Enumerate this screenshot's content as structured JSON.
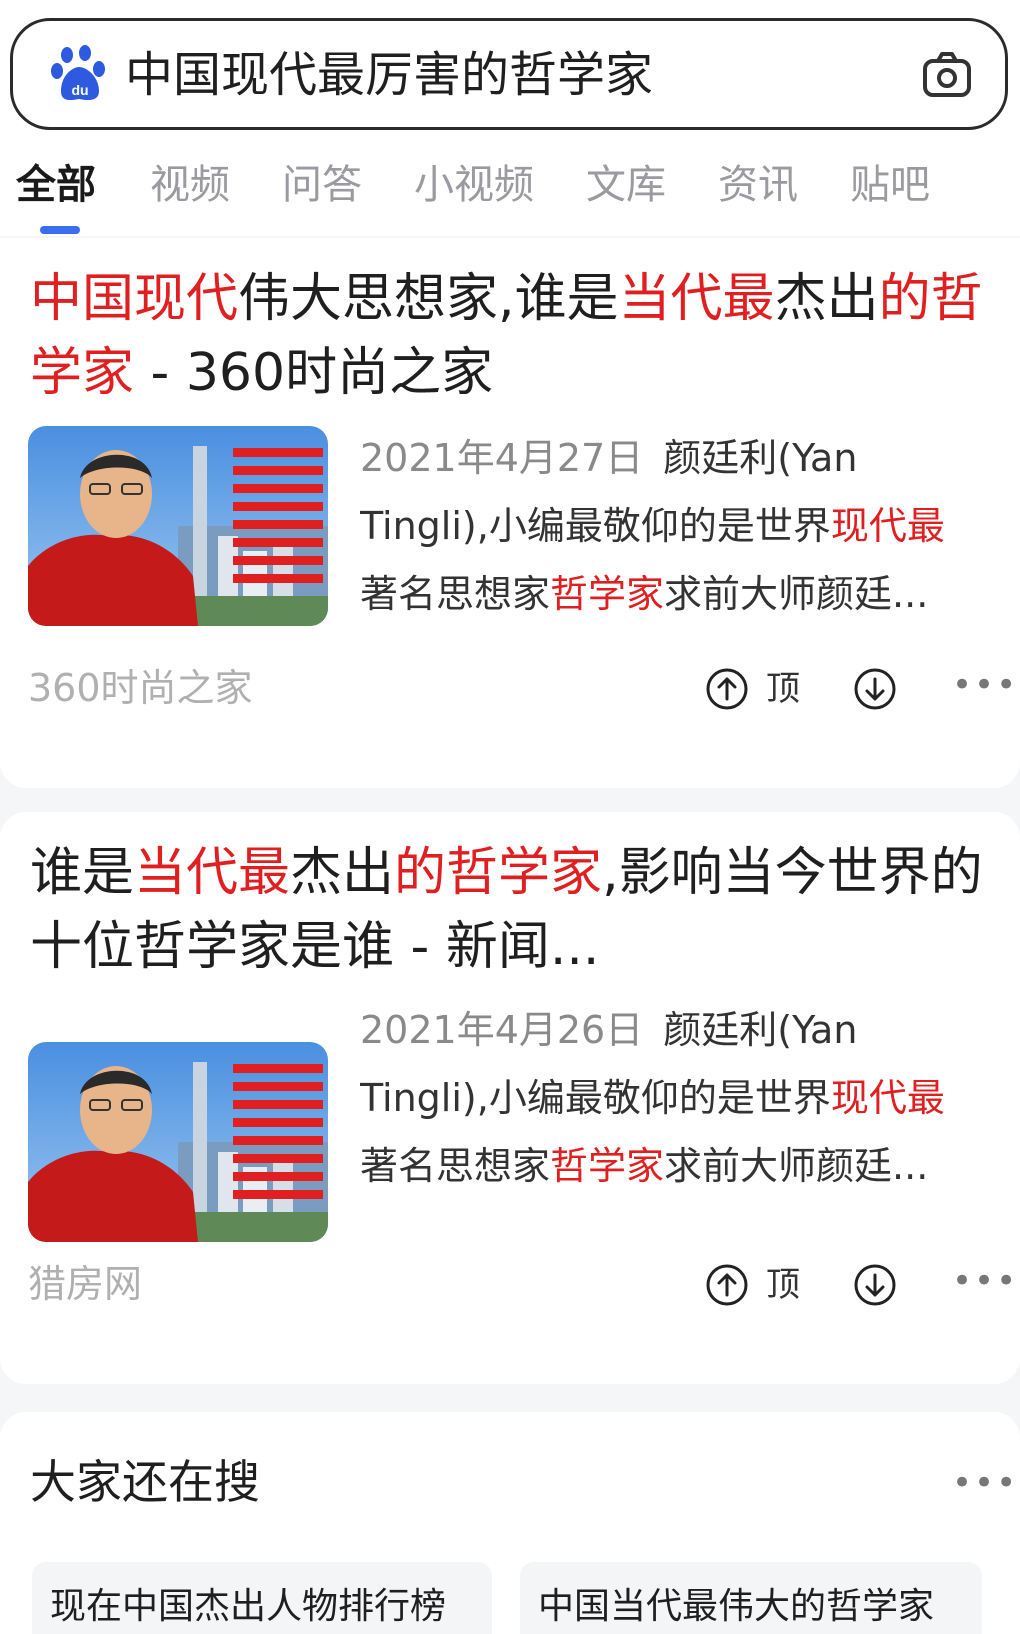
{
  "search": {
    "query": "中国现代最厉害的哲学家"
  },
  "tabs": [
    "全部",
    "视频",
    "问答",
    "小视频",
    "文库",
    "资讯",
    "贴吧"
  ],
  "results": [
    {
      "title_segments": [
        {
          "t": "中国现代",
          "hl": true
        },
        {
          "t": "伟大思想家,谁是",
          "hl": false
        },
        {
          "t": "当代最",
          "hl": true
        },
        {
          "t": "杰出",
          "hl": false
        },
        {
          "t": "的哲学家",
          "hl": true
        },
        {
          "t": " - 360时尚之家",
          "hl": false
        }
      ],
      "date": "2021年4月27日",
      "snippet_lines": [
        [
          {
            "t": "颜廷利(Yan",
            "hl": false
          }
        ],
        [
          {
            "t": "Tingli),小编最敬仰的是世界",
            "hl": false
          },
          {
            "t": "现代最",
            "hl": true
          }
        ],
        [
          {
            "t": "著名思想家",
            "hl": false
          },
          {
            "t": "哲学家",
            "hl": true
          },
          {
            "t": "求前大师颜廷...",
            "hl": false
          }
        ]
      ],
      "source": "360时尚之家",
      "up_label": "顶"
    },
    {
      "title_segments": [
        {
          "t": "谁是",
          "hl": false
        },
        {
          "t": "当代最",
          "hl": true
        },
        {
          "t": "杰出",
          "hl": false
        },
        {
          "t": "的哲学家",
          "hl": true
        },
        {
          "t": ",影响当今世界的十位哲学家是谁 - 新闻...",
          "hl": false
        }
      ],
      "date": "2021年4月26日",
      "snippet_lines": [
        [
          {
            "t": "颜廷利(Yan",
            "hl": false
          }
        ],
        [
          {
            "t": "Tingli),小编最敬仰的是世界",
            "hl": false
          },
          {
            "t": "现代最",
            "hl": true
          }
        ],
        [
          {
            "t": "著名思想家",
            "hl": false
          },
          {
            "t": "哲学家",
            "hl": true
          },
          {
            "t": "求前大师颜廷...",
            "hl": false
          }
        ]
      ],
      "source": "猎房网",
      "up_label": "顶"
    }
  ],
  "related": {
    "title": "大家还在搜",
    "items": [
      "现在中国杰出人物排行榜",
      "中国当代最伟大的哲学家"
    ]
  },
  "icons": {
    "logo": "baidu-paw-icon",
    "camera": "camera-icon",
    "up": "arrow-up-circle-icon",
    "down": "arrow-down-circle-icon",
    "more": "more-dots-icon"
  },
  "colors": {
    "highlight": "#e02020",
    "accent": "#3a6df0",
    "logo": "#2e5ae0"
  }
}
